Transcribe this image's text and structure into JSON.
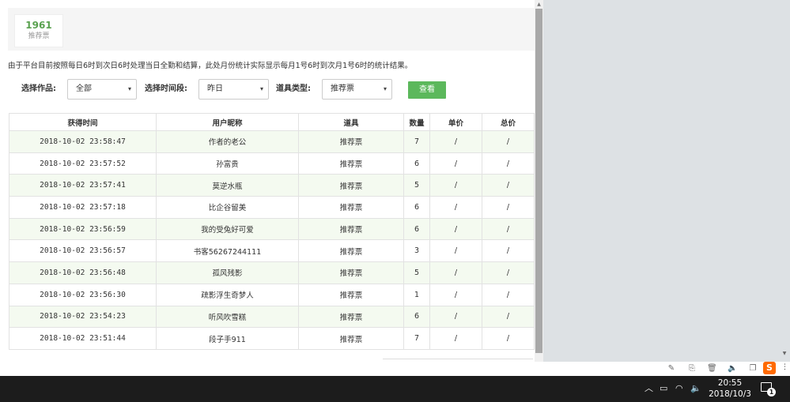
{
  "stat": {
    "number": "1961",
    "label": "推荐票"
  },
  "notice": "由于平台目前按照每日6时到次日6时处理当日全勤和结算，此处月份统计实际显示每月1号6时到次月1号6时的统计结果。",
  "filters": {
    "work_label": "选择作品:",
    "work_value": "全部",
    "period_label": "选择时间段:",
    "period_value": "昨日",
    "type_label": "道具类型:",
    "type_value": "推荐票"
  },
  "query_button": "查看",
  "table": {
    "headers": [
      "获得时间",
      "用户昵称",
      "道具",
      "数量",
      "单价",
      "总价"
    ],
    "rows": [
      [
        "2018-10-02 23:58:47",
        "作者的老公",
        "推荐票",
        "7",
        "/",
        "/"
      ],
      [
        "2018-10-02 23:57:52",
        "孙富贵",
        "推荐票",
        "6",
        "/",
        "/"
      ],
      [
        "2018-10-02 23:57:41",
        "莫逆水瓶",
        "推荐票",
        "5",
        "/",
        "/"
      ],
      [
        "2018-10-02 23:57:18",
        "比企谷留美",
        "推荐票",
        "6",
        "/",
        "/"
      ],
      [
        "2018-10-02 23:56:59",
        "我的受兔好可爱",
        "推荐票",
        "6",
        "/",
        "/"
      ],
      [
        "2018-10-02 23:56:57",
        "书客56267244111",
        "推荐票",
        "3",
        "/",
        "/"
      ],
      [
        "2018-10-02 23:56:48",
        "孤风残影",
        "推荐票",
        "5",
        "/",
        "/"
      ],
      [
        "2018-10-02 23:56:30",
        "疏影浮生奇梦人",
        "推荐票",
        "1",
        "/",
        "/"
      ],
      [
        "2018-10-02 23:54:23",
        "听风吹雪糕",
        "推荐票",
        "6",
        "/",
        "/"
      ],
      [
        "2018-10-02 23:51:44",
        "段子手911",
        "推荐票",
        "7",
        "/",
        "/"
      ]
    ]
  },
  "taskbar": {
    "time": "20:55",
    "date": "2018/10/3",
    "notification_count": "1"
  },
  "icons": {
    "dropdown": "▾",
    "scroll_up": "▲",
    "scroll_down": "▼",
    "tool_a": "✎",
    "tool_b": "⎘",
    "tool_c": "🗑",
    "tool_d": "🔈",
    "tool_e": "❐",
    "sogou": "S",
    "more": "⋮",
    "tray_up": "︿",
    "tray_battery": "▭",
    "tray_wifi": "◠",
    "tray_volume": "🔈"
  },
  "colors": {
    "accent": "#5cb85c",
    "stat_number": "#59a14f",
    "row_stripe": "#f4faf0",
    "sogou": "#ff6a00"
  }
}
